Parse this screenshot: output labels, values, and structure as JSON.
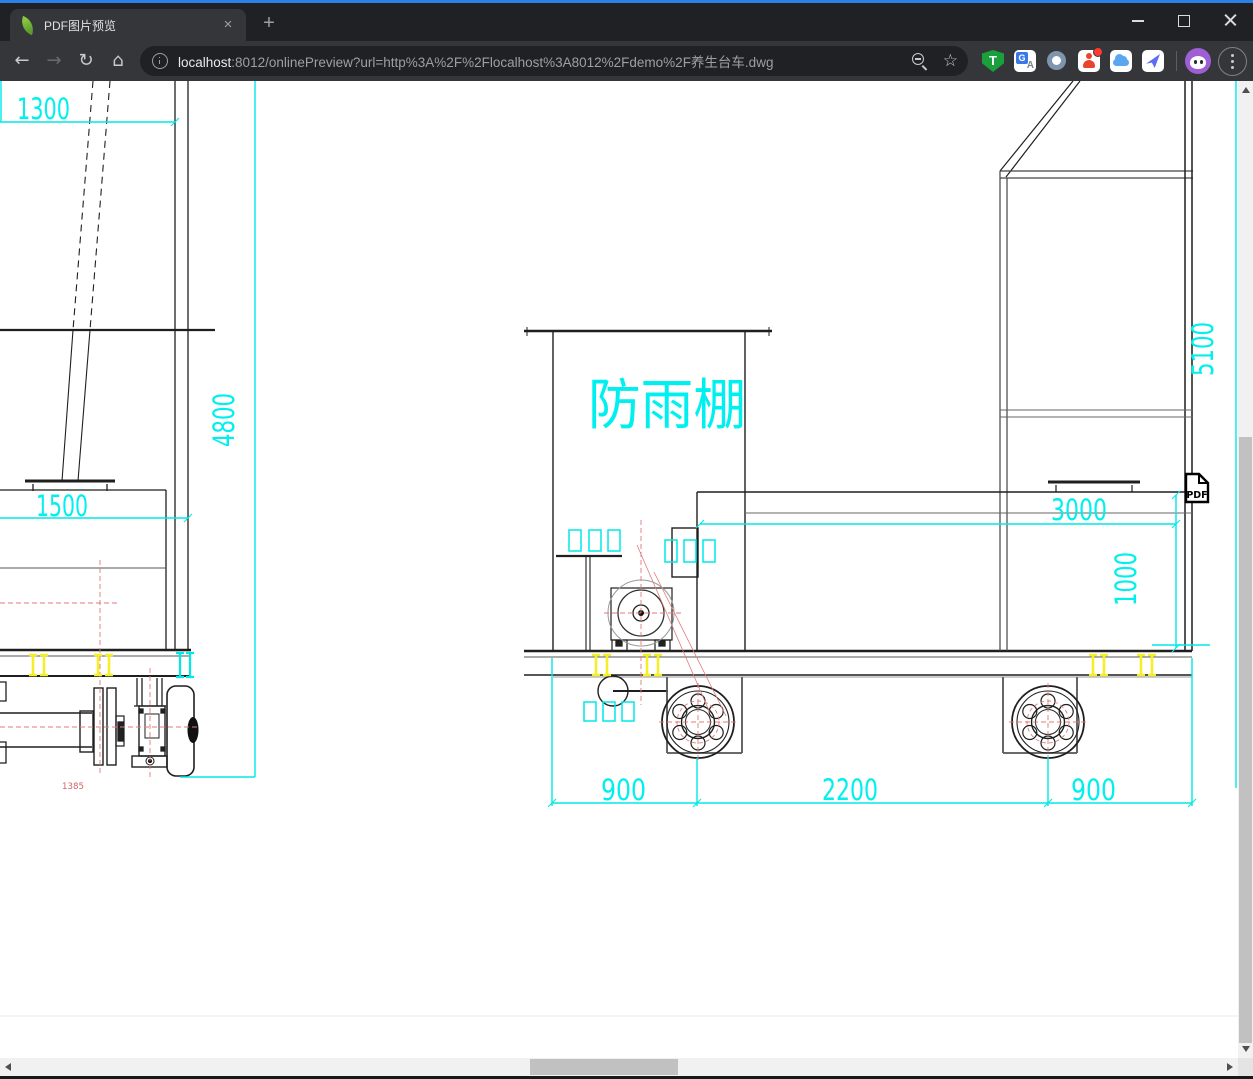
{
  "tab": {
    "title": "PDF图片预览"
  },
  "icons": {
    "close": "×",
    "plus": "+",
    "back": "←",
    "forward": "→",
    "reload": "↻",
    "home": "⌂",
    "star": "☆"
  },
  "url": {
    "host": "localhost",
    "rest": ":8012/onlinePreview?url=http%3A%2F%2Flocalhost%3A8012%2Fdemo%2F养生台车.dwg"
  },
  "toolbar": {
    "extensions": [
      {
        "name": "tampermonkey",
        "glyph": "T"
      },
      {
        "name": "translate",
        "glyph": "G",
        "glyph2": "A"
      },
      {
        "name": "ring-extension"
      },
      {
        "name": "people-extension"
      },
      {
        "name": "cloud-extension"
      },
      {
        "name": "bird-extension"
      }
    ]
  },
  "viewer": {
    "pdf_label": "PDF"
  },
  "colors": {
    "dimension": "#00efef",
    "highlight": "#f5ef2a",
    "centerline": "#e07a7a",
    "accent_strip": "#2a82e8"
  },
  "drawing": {
    "shelter_label": "防雨棚",
    "dims": {
      "top_left_width": "1300",
      "left_height": "4800",
      "left_box_width": "1500",
      "left_small_width": "1385",
      "shed_top_width": "3000",
      "frame_height": "1000",
      "right_height": "5100",
      "axle_left_offset": "900",
      "axle_spacing": "2200",
      "axle_right_offset": "900"
    }
  }
}
